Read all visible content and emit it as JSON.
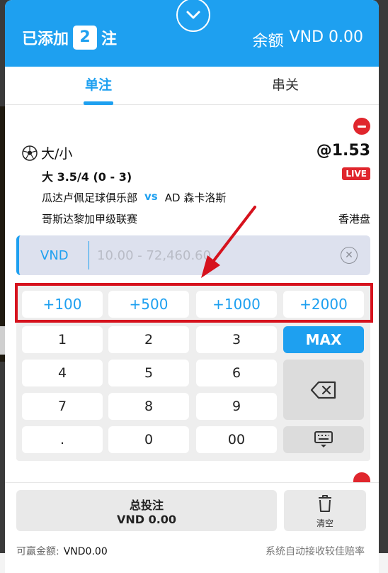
{
  "header": {
    "added_prefix": "已添加",
    "count": "2",
    "added_suffix": "注",
    "balance_label": "余额",
    "balance_value": "VND 0.00"
  },
  "tabs": [
    {
      "label": "单注",
      "active": true
    },
    {
      "label": "串关",
      "active": false
    }
  ],
  "bet": {
    "market": "大/小",
    "odds": "@1.53",
    "selection": "大 3.5/4 (0 - 3)",
    "live_label": "LIVE",
    "home_team": "瓜达卢佩足球俱乐部",
    "vs": "vs",
    "away_team": "AD 森卡洛斯",
    "league": "哥斯达黎加甲级联赛",
    "odds_type": "香港盘"
  },
  "stake": {
    "currency": "VND",
    "placeholder": "10.00 - 72,460.60"
  },
  "keypad": {
    "quick": [
      "+100",
      "+500",
      "+1000",
      "+2000"
    ],
    "max_label": "MAX",
    "digits": [
      "1",
      "2",
      "3",
      "4",
      "5",
      "6",
      "7",
      "8",
      "9",
      ".",
      "0",
      "00"
    ]
  },
  "footer": {
    "total_label": "总投注",
    "total_value": "VND 0.00",
    "clear_label": "清空",
    "winnable_label": "可赢金额:",
    "winnable_value": "VND0.00",
    "auto_accept": "系统自动接收较佳赔率"
  },
  "colors": {
    "accent": "#1ea0f0",
    "live": "#e0262d",
    "annotation": "#d6121d"
  }
}
